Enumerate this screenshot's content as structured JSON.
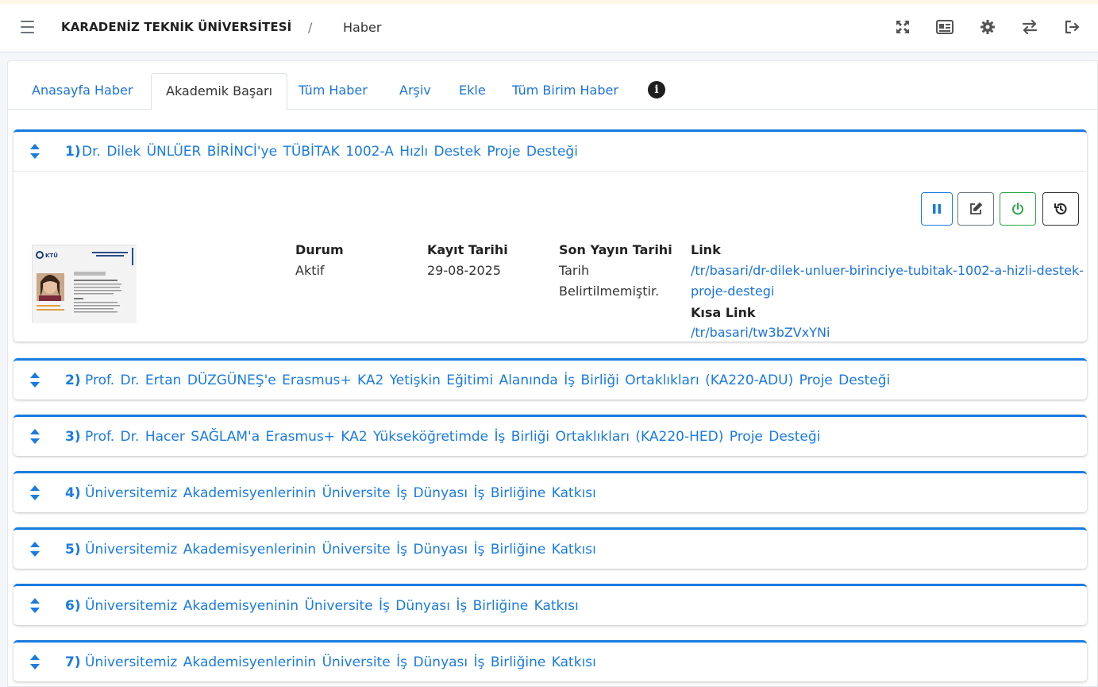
{
  "header": {
    "brand": "KARADENİZ TEKNİK ÜNİVERSİTESİ",
    "separator": "/",
    "breadcrumb": "Haber",
    "icons": [
      "fullscreen-icon",
      "id-card-icon",
      "gear-icon",
      "switch-arrows-icon",
      "logout-icon"
    ]
  },
  "tabs": [
    {
      "label": "Anasayfa Haber",
      "active": false
    },
    {
      "label": "Akademik Başarı",
      "active": true
    },
    {
      "label": "Tüm Haber",
      "active": false
    },
    {
      "label": "Arşiv",
      "active": false
    },
    {
      "label": "Ekle",
      "active": false
    },
    {
      "label": "Tüm Birim Haber",
      "active": false
    }
  ],
  "items": [
    {
      "num": "1)",
      "title": "Dr. Dilek ÜNLÜER BİRİNCİ'ye TÜBİTAK 1002-A Hızlı Destek Proje Desteği"
    },
    {
      "num": "2)",
      "title": "Prof. Dr. Ertan DÜZGÜNEŞ'e Erasmus+ KA2 Yetişkin Eğitimi Alanında İş Birliği Ortaklıkları (KA220-ADU) Proje Desteği"
    },
    {
      "num": "3)",
      "title": "Prof. Dr. Hacer SAĞLAM'a Erasmus+ KA2 Yükseköğretimde İş Birliği Ortaklıkları (KA220-HED) Proje Desteği"
    },
    {
      "num": "4)",
      "title": "Üniversitemiz Akademisyenlerinin Üniversite İş Dünyası İş Birliğine Katkısı"
    },
    {
      "num": "5)",
      "title": "Üniversitemiz Akademisyenlerinin Üniversite İş Dünyası İş Birliğine Katkısı"
    },
    {
      "num": "6)",
      "title": "Üniversitemiz Akademisyeninin Üniversite İş Dünyası İş Birliğine Katkısı"
    },
    {
      "num": "7)",
      "title": "Üniversitemiz Akademisyenlerinin Üniversite İş Dünyası İş Birliğine Katkısı"
    }
  ],
  "detail": {
    "durum_label": "Durum",
    "durum_value": "Aktif",
    "kayit_label": "Kayıt Tarihi",
    "kayit_value": "29-08-2025",
    "yayin_label": "Son Yayın Tarihi",
    "yayin_value_1": "Tarih",
    "yayin_value_2": "Belirtilmemiştir.",
    "link_label": "Link",
    "link_value_1": "/tr/basari/dr-dilek-unluer-birinciye-tubitak-1002-a-hizli-destek-",
    "link_value_2": "proje-destegi",
    "short_label": "Kısa Link",
    "short_value": "/tr/basari/tw3bZVxYNi",
    "thumb_logo": "KTÜ",
    "buttons": [
      "pause-icon",
      "edit-icon",
      "power-icon",
      "history-icon"
    ]
  },
  "colors": {
    "accent": "#1a7be0",
    "link": "#1a73d9",
    "success": "#28a745"
  }
}
